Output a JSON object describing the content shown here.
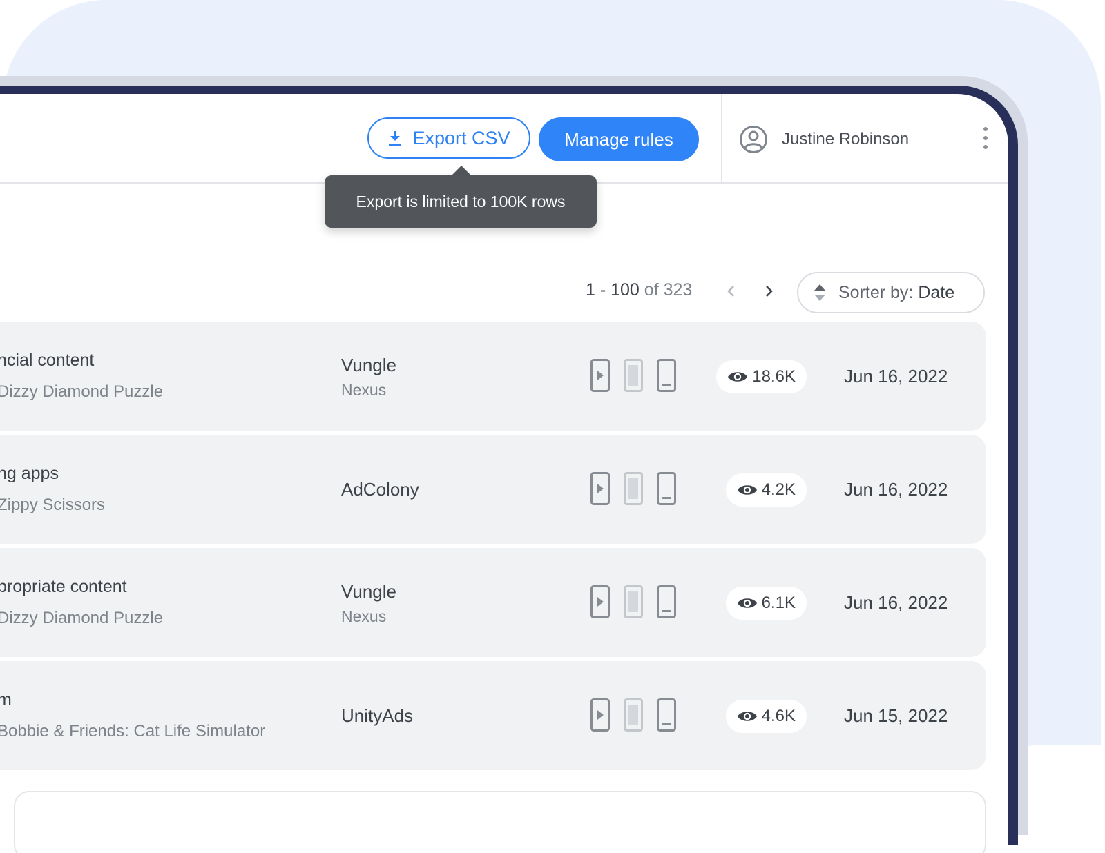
{
  "header": {
    "export_label": "Export CSV",
    "manage_label": "Manage rules",
    "user_name": "Justine Robinson",
    "tooltip": "Export is limited to 100K rows"
  },
  "pager": {
    "range": "1 - 100",
    "of_total": "of 323"
  },
  "sorter": {
    "label": "Sorter by:",
    "value": "Date"
  },
  "rows": [
    {
      "title": "ncial content",
      "app": "Dizzy Diamond Puzzle",
      "network": "Vungle",
      "network_sub": "Nexus",
      "views": "18.6K",
      "date": "Jun 16, 2022"
    },
    {
      "title": "ng apps",
      "app": "Zippy Scissors",
      "network": "AdColony",
      "network_sub": "",
      "views": "4.2K",
      "date": "Jun 16, 2022"
    },
    {
      "title": "propriate content",
      "app": "Dizzy Diamond Puzzle",
      "network": "Vungle",
      "network_sub": "Nexus",
      "views": "6.1K",
      "date": "Jun 16, 2022"
    },
    {
      "title": "m",
      "app": "Bobbie & Friends: Cat Life Simulator",
      "network": "UnityAds",
      "network_sub": "",
      "views": "4.6K",
      "date": "Jun 15, 2022"
    }
  ],
  "colors": {
    "accent": "#2f85f7",
    "row_bg": "#f1f2f4",
    "tooltip_bg": "#52565b",
    "frame": "#28305a",
    "page_bg": "#eaf1fc"
  },
  "icons": {
    "export": "download-icon",
    "user": "user-circle-icon",
    "menu": "more-vertical-icon",
    "sort": "sort-icon",
    "views": "eye-icon",
    "devices": [
      "phone-video-icon",
      "phone-static-icon",
      "phone-icon"
    ]
  }
}
